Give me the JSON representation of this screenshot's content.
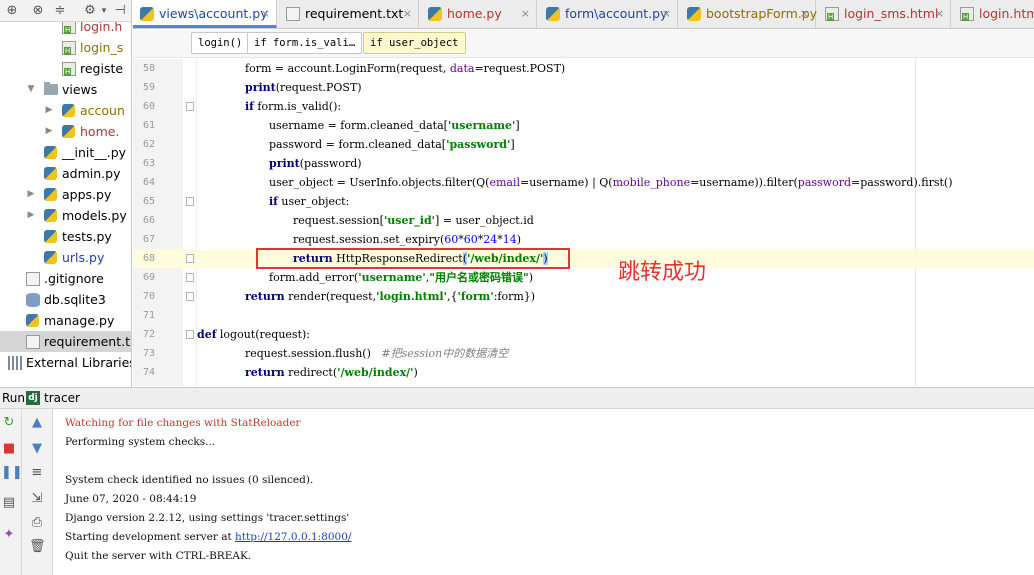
{
  "project_tree": [
    {
      "label": "login.h",
      "icon": "html-file-icon",
      "color": "red",
      "indent": 2,
      "arrow": ""
    },
    {
      "label": "login_s",
      "icon": "html-file-icon",
      "color": "yellow",
      "indent": 2,
      "arrow": ""
    },
    {
      "label": "registe",
      "icon": "html-file-icon",
      "color": "",
      "indent": 2,
      "arrow": ""
    },
    {
      "label": "views",
      "icon": "folder-icon",
      "color": "",
      "indent": 1,
      "arrow": "▼"
    },
    {
      "label": "accoun",
      "icon": "python-file-icon",
      "color": "yellow",
      "indent": 2,
      "arrow": "▶"
    },
    {
      "label": "home.",
      "icon": "python-file-icon",
      "color": "red",
      "indent": 2,
      "arrow": "▶"
    },
    {
      "label": "__init__.py",
      "icon": "python-file-icon",
      "color": "",
      "indent": 1,
      "arrow": ""
    },
    {
      "label": "admin.py",
      "icon": "python-file-icon",
      "color": "",
      "indent": 1,
      "arrow": ""
    },
    {
      "label": "apps.py",
      "icon": "python-file-icon",
      "color": "",
      "indent": 1,
      "arrow": "▶"
    },
    {
      "label": "models.py",
      "icon": "python-file-icon",
      "color": "",
      "indent": 1,
      "arrow": "▶"
    },
    {
      "label": "tests.py",
      "icon": "python-file-icon",
      "color": "",
      "indent": 1,
      "arrow": ""
    },
    {
      "label": "urls.py",
      "icon": "python-file-icon",
      "color": "blue",
      "indent": 1,
      "arrow": ""
    },
    {
      "label": ".gitignore",
      "icon": "text-file-icon",
      "color": "",
      "indent": 0,
      "arrow": ""
    },
    {
      "label": "db.sqlite3",
      "icon": "database-icon",
      "color": "",
      "indent": 0,
      "arrow": ""
    },
    {
      "label": "manage.py",
      "icon": "python-file-icon",
      "color": "",
      "indent": 0,
      "arrow": ""
    },
    {
      "label": "requirement.t",
      "icon": "text-file-icon",
      "color": "",
      "indent": 0,
      "arrow": "",
      "selected": true
    },
    {
      "label": "External Libraries",
      "icon": "library-icon",
      "color": "",
      "indent": -1,
      "arrow": "▶"
    }
  ],
  "tabs": [
    {
      "label": "views\\account.py",
      "icon": "python",
      "active": true,
      "color": "#2244aa"
    },
    {
      "label": "requirement.txt",
      "icon": "text",
      "active": false,
      "color": "#000000"
    },
    {
      "label": "home.py",
      "icon": "python",
      "active": false,
      "color": "#b33434"
    },
    {
      "label": "form\\account.py",
      "icon": "python",
      "active": false,
      "color": "#2244aa"
    },
    {
      "label": "bootstrapForm.py",
      "icon": "python",
      "active": false,
      "color": "#8e6e00"
    },
    {
      "label": "login_sms.html",
      "icon": "html",
      "active": false,
      "color": "#b33434"
    },
    {
      "label": "login.htm",
      "icon": "html",
      "active": false,
      "color": "#b33434"
    }
  ],
  "breadcrumbs": [
    "login()",
    "if form.is_vali…",
    "if user_object"
  ],
  "code_lines": [
    {
      "n": "58",
      "indent": 2,
      "html": "form = account.LoginForm(request, <span class=\"kwarg\">data</span>=request.POST)"
    },
    {
      "n": "59",
      "indent": 2,
      "html": "<span class=\"kw\">print</span>(request.POST)"
    },
    {
      "n": "60",
      "indent": 2,
      "html": "<span class=\"kw\">if</span> form.is_valid():",
      "fold": true
    },
    {
      "n": "61",
      "indent": 3,
      "html": "username = form.cleaned_data[<span class=\"str\">'username'</span>]"
    },
    {
      "n": "62",
      "indent": 3,
      "html": "password = form.cleaned_data[<span class=\"str\">'password'</span>]"
    },
    {
      "n": "63",
      "indent": 3,
      "html": "<span class=\"kw\">print</span>(password)"
    },
    {
      "n": "64",
      "indent": 3,
      "html": "user_object = UserInfo.objects.filter(Q(<span class=\"kwarg\">email</span>=username) | Q(<span class=\"kwarg\">mobile_phone</span>=username)).filter(<span class=\"kwarg\">password</span>=password).first()"
    },
    {
      "n": "65",
      "indent": 3,
      "html": "<span class=\"kw\">if</span> user_object:",
      "fold": true
    },
    {
      "n": "66",
      "indent": 4,
      "html": "request.session[<span class=\"str\">'user_id'</span>] = user_object.id"
    },
    {
      "n": "67",
      "indent": 4,
      "html": "request.session.set_expiry(<span class=\"num\">60</span>*<span class=\"num\">60</span>*<span class=\"num\">24</span>*<span class=\"num\">14</span>)"
    },
    {
      "n": "68",
      "indent": 4,
      "html": "<span class=\"kw\">return</span> HttpResponseRedirect<span class=\"hl-paren\">(</span><span class=\"str\">'/web/index/'</span><span class=\"hl-paren\">)</span>",
      "current": true,
      "fold": true
    },
    {
      "n": "69",
      "indent": 3,
      "html": "form.add_error(<span class=\"str\">'username'</span>,<span class=\"str\">\"用户名或密码错误\"</span>)",
      "fold": true
    },
    {
      "n": "70",
      "indent": 2,
      "html": "<span class=\"kw\">return</span> render(request,<span class=\"str\">'login.html'</span>,{<span class=\"str\">'form'</span>:form})",
      "fold": true
    },
    {
      "n": "71",
      "indent": 0,
      "html": ""
    },
    {
      "n": "72",
      "indent": 0,
      "html": "<span class=\"kw\">def</span> logout(request):",
      "fold": true
    },
    {
      "n": "73",
      "indent": 2,
      "html": "request.session.flush()   <span class=\"cmt\">#把session中的数据清空</span>"
    },
    {
      "n": "74",
      "indent": 2,
      "html": "<span class=\"kw\">return</span> redirect(<span class=\"str\">'/web/index/'</span>)"
    }
  ],
  "annotation": "跳转成功",
  "run_panel": {
    "run_label": "Run",
    "config_name": "tracer",
    "console_lines": [
      {
        "text": "Watching for file changes with StatReloader",
        "type": "err"
      },
      {
        "text": "Performing system checks...",
        "type": "out"
      },
      {
        "text": "",
        "type": "out"
      },
      {
        "text": "System check identified no issues (0 silenced).",
        "type": "out"
      },
      {
        "text": "June 07, 2020 - 08:44:19",
        "type": "out"
      },
      {
        "text": "Django version 2.2.12, using settings 'tracer.settings'",
        "type": "out"
      },
      {
        "text": "Starting development server at ",
        "type": "out",
        "link": "http://127.0.0.1:8000/"
      },
      {
        "text": "Quit the server with CTRL-BREAK.",
        "type": "out"
      }
    ]
  },
  "colors": {
    "accent": "#4a89dc",
    "annotation": "#e8322d",
    "keyword": "#000080",
    "string": "#008000"
  }
}
